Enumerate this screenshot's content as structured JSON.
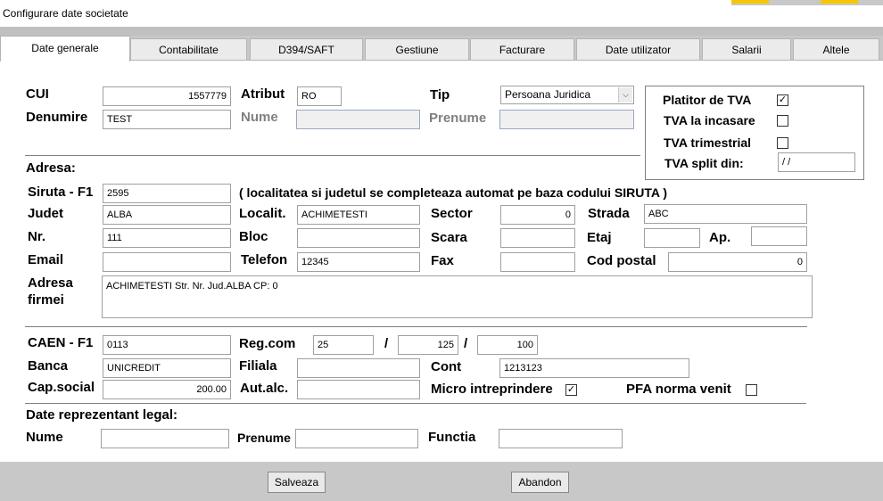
{
  "window": {
    "title": "Configurare date societate"
  },
  "tabs": [
    "Date generale",
    "Contabilitate",
    "D394/SAFT",
    "Gestiune",
    "Facturare",
    "Date utilizator",
    "Salarii",
    "Altele"
  ],
  "form": {
    "cui_label": "CUI",
    "cui_value": "1557779",
    "atribut_label": "Atribut",
    "atribut_value": "RO",
    "tip_label": "Tip",
    "tip_value": "Persoana Juridica",
    "denumire_label": "Denumire",
    "denumire_value": "TEST",
    "nume_label": "Nume",
    "prenume_label": "Prenume",
    "adresa_label": "Adresa:",
    "siruta_label": "Siruta - F1",
    "siruta_value": "2595",
    "siruta_note": "( localitatea si judetul se completeaza automat pe baza codului SIRUTA )",
    "judet_label": "Judet",
    "judet_value": "ALBA",
    "localit_label": "Localit.",
    "localit_value": "ACHIMETESTI",
    "sector_label": "Sector",
    "sector_value": "0",
    "strada_label": "Strada",
    "strada_value": "ABC",
    "nr_label": "Nr.",
    "nr_value": "111",
    "bloc_label": "Bloc",
    "scara_label": "Scara",
    "etaj_label": "Etaj",
    "ap_label": "Ap.",
    "email_label": "Email",
    "telefon_label": "Telefon",
    "telefon_value": "12345",
    "fax_label": "Fax",
    "codpostal_label": "Cod postal",
    "codpostal_value": "0",
    "adresa_firmei_label1": "Adresa",
    "adresa_firmei_label2": "firmei",
    "adresa_firmei_value": "ACHIMETESTI Str. Nr. Jud.ALBA CP: 0",
    "caen_label": "CAEN - F1",
    "caen_value": "0113",
    "regcom_label": "Reg.com",
    "regcom_1": "25",
    "regcom_2": "125",
    "regcom_3": "100",
    "slash": "/",
    "banca_label": "Banca",
    "banca_value": "UNICREDIT",
    "filiala_label": "Filiala",
    "cont_label": "Cont",
    "cont_value": "1213123",
    "capsocial_label": "Cap.social",
    "capsocial_value": "200.00",
    "autalc_label": "Aut.alc.",
    "micro_label": "Micro intreprindere",
    "micro_checked": "✓",
    "pfa_label": "PFA norma venit",
    "reprez_label": "Date reprezentant legal:",
    "rep_nume_label": "Nume",
    "rep_prenume_label": "Prenume",
    "rep_functia_label": "Functia"
  },
  "tva": {
    "platitor_label": "Platitor de TVA",
    "platitor_checked": "✓",
    "incasare_label": "TVA la incasare",
    "trimestrial_label": "TVA trimestrial",
    "split_label": "TVA split din:",
    "split_value": "/ /"
  },
  "buttons": {
    "save": "Salveaza",
    "cancel": "Abandon"
  }
}
